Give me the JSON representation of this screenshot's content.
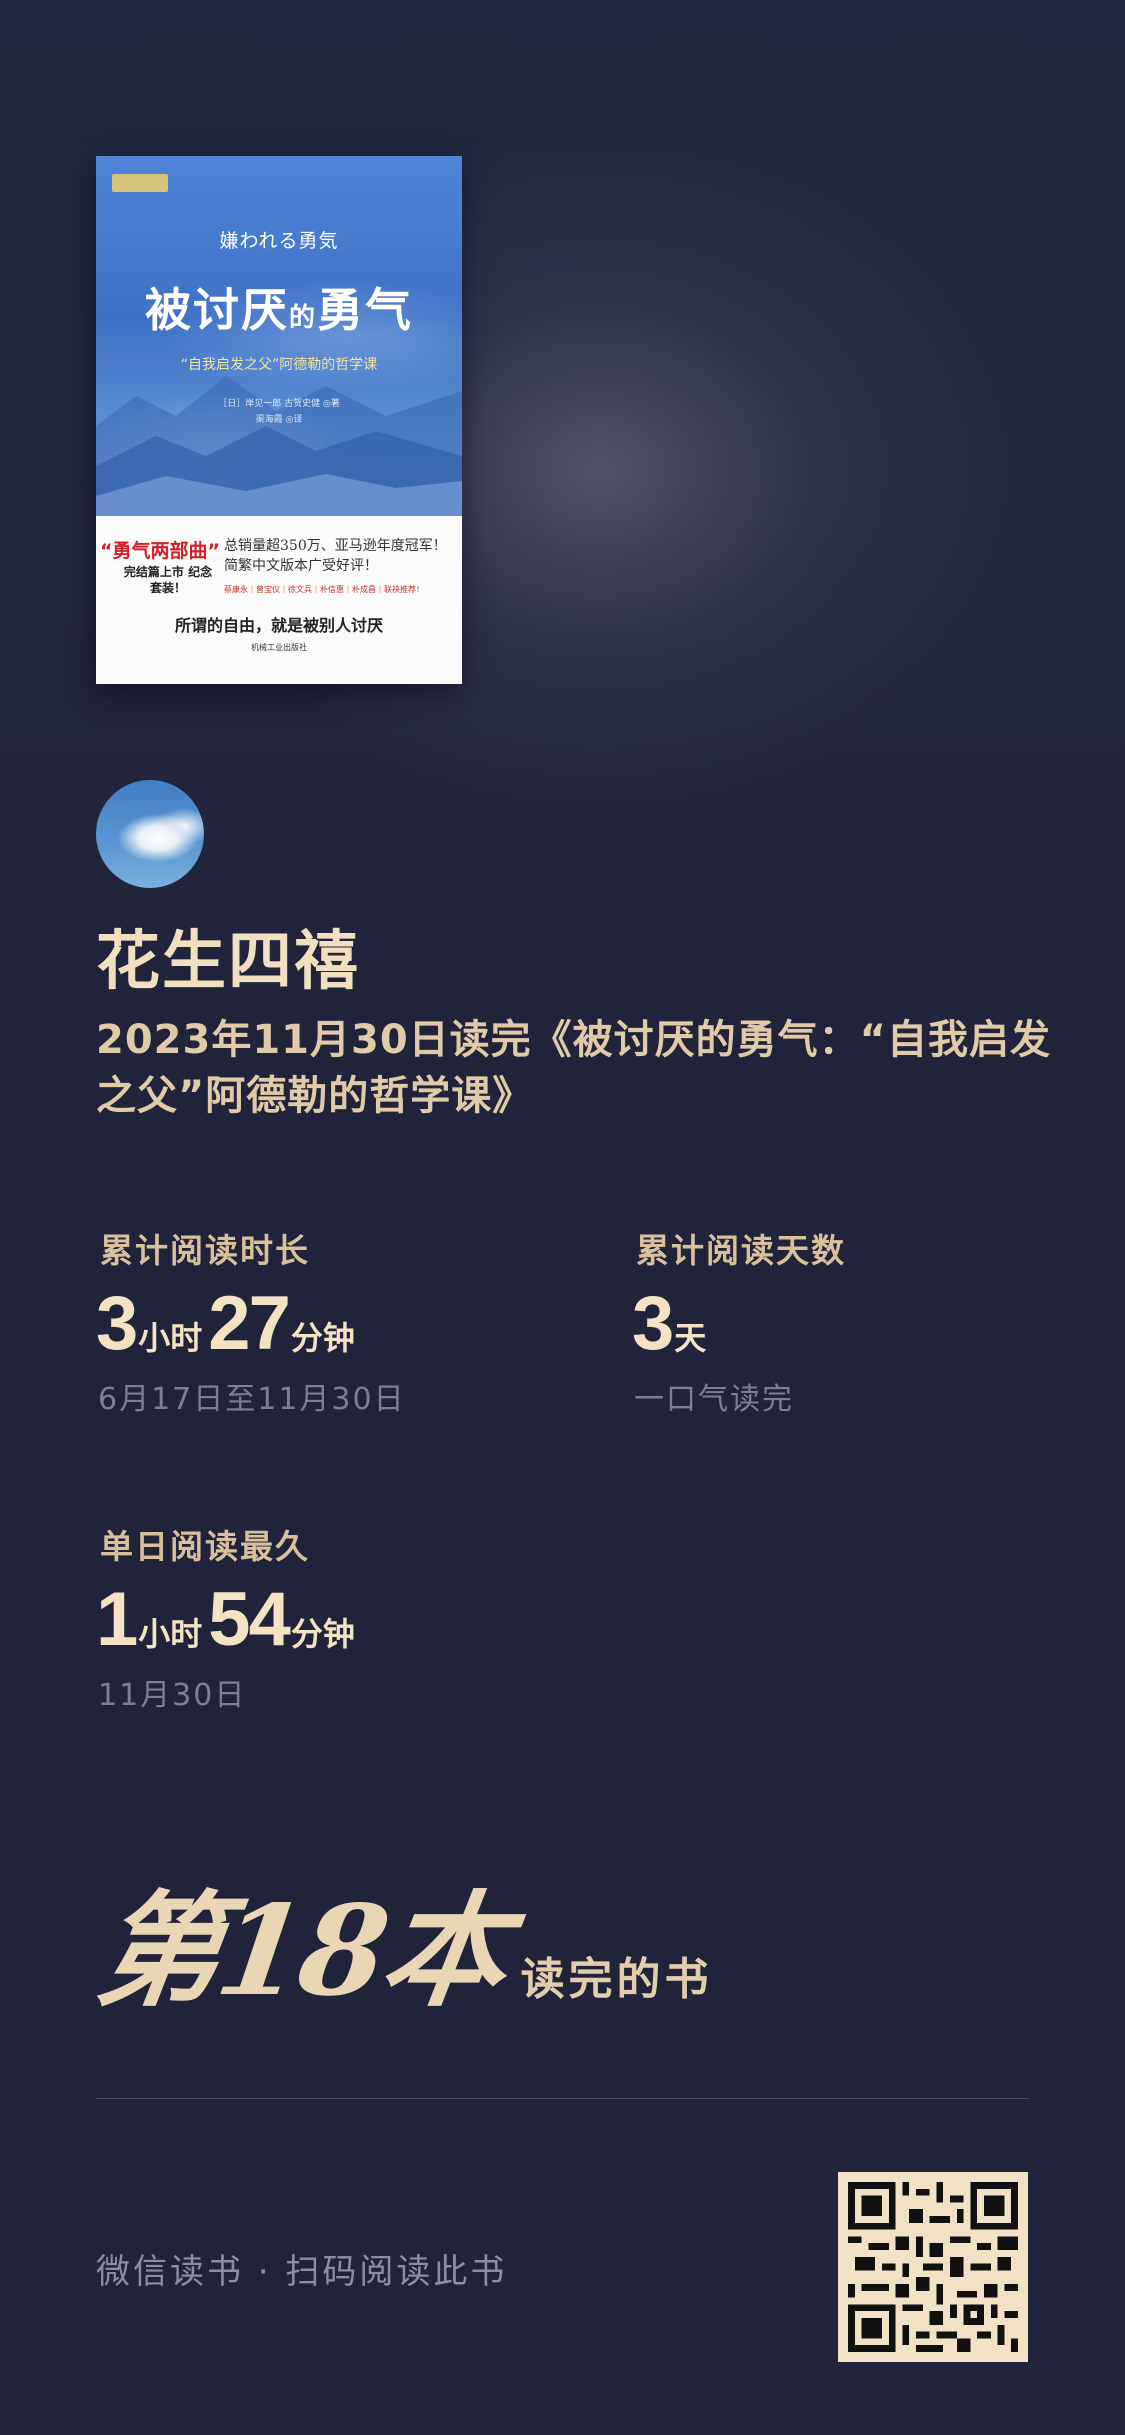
{
  "colors": {
    "background": "#21233b",
    "accent_text": "#e8d5b5",
    "muted_text": "#7c7f98",
    "qr_background": "#f1e2c6"
  },
  "book_cover": {
    "japanese_title": "嫌われる勇気",
    "title_main_1": "被讨厌",
    "title_small": "的",
    "title_main_2": "勇气",
    "subtitle": "“自我启发之父”阿德勒的哲学课",
    "authors": "［日］岸见一郎 古贺史健 ◎著",
    "translator": "渠海霞 ◎译",
    "series_label": "“勇气两部曲”",
    "series_note": "完结篇上市 纪念套装！",
    "blurb": "总销量超350万、亚马逊年度冠军！简繁中文版本广受好评！",
    "recommenders": "蔡康永｜曾宝仪｜徐文兵｜朴信惠｜朴成昌｜联袂推荐！",
    "motto": "所谓的自由，就是被别人讨厌",
    "publisher": "机械工业出版社"
  },
  "user": {
    "avatar": "cloud-sky-avatar",
    "name": "花生四禧"
  },
  "finished_line": "2023年11月30日读完《被讨厌的勇气：“自我启发之父”阿德勒的哲学课》",
  "stats": {
    "total_time": {
      "label": "累计阅读时长",
      "hours": "3",
      "hours_unit": "小时",
      "minutes": "27",
      "minutes_unit": "分钟",
      "range": "6月17日至11月30日"
    },
    "total_days": {
      "label": "累计阅读天数",
      "days": "3",
      "days_unit": "天",
      "note": "一口气读完"
    },
    "longest_day": {
      "label": "单日阅读最久",
      "hours": "1",
      "hours_unit": "小时",
      "minutes": "54",
      "minutes_unit": "分钟",
      "date": "11月30日"
    }
  },
  "rank": {
    "big": "第18本",
    "small": "读完的书"
  },
  "footer": {
    "text": "微信读书 · 扫码阅读此书",
    "qr_icon": "qr-code-icon"
  }
}
